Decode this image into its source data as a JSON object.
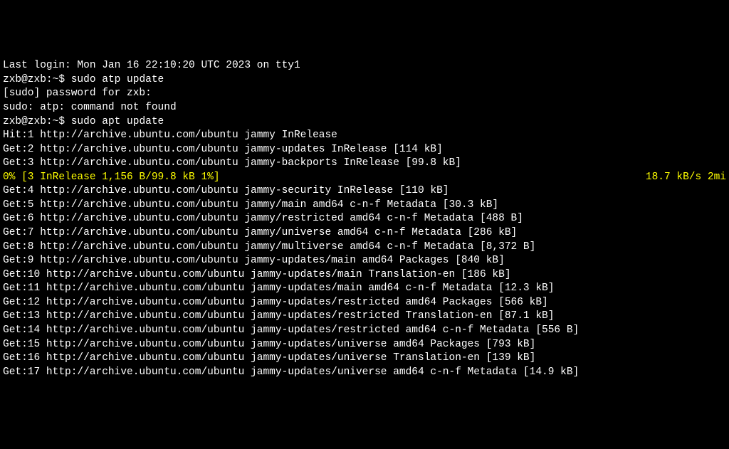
{
  "lines": {
    "last_login": "Last login: Mon Jan 16 22:10:20 UTC 2023 on tty1",
    "prompt1_user": "zxb@zxb",
    "prompt1_path": ":~$ ",
    "prompt1_cmd": "sudo atp update",
    "sudo_pw": "[sudo] password for zxb:",
    "sudo_err": "sudo: atp: command not found",
    "prompt2_user": "zxb@zxb",
    "prompt2_path": ":~$ ",
    "prompt2_cmd": "sudo apt update",
    "hit1": "Hit:1 http://archive.ubuntu.com/ubuntu jammy InRelease",
    "get2": "Get:2 http://archive.ubuntu.com/ubuntu jammy-updates InRelease [114 kB]",
    "get3": "Get:3 http://archive.ubuntu.com/ubuntu jammy-backports InRelease [99.8 kB]",
    "progress_left": "0% [3 InRelease 1,156 B/99.8 kB 1%]",
    "progress_right": "18.7 kB/s 2mi",
    "get4": "Get:4 http://archive.ubuntu.com/ubuntu jammy-security InRelease [110 kB]",
    "get5": "Get:5 http://archive.ubuntu.com/ubuntu jammy/main amd64 c-n-f Metadata [30.3 kB]",
    "get6": "Get:6 http://archive.ubuntu.com/ubuntu jammy/restricted amd64 c-n-f Metadata [488 B]",
    "get7": "Get:7 http://archive.ubuntu.com/ubuntu jammy/universe amd64 c-n-f Metadata [286 kB]",
    "get8": "Get:8 http://archive.ubuntu.com/ubuntu jammy/multiverse amd64 c-n-f Metadata [8,372 B]",
    "get9": "Get:9 http://archive.ubuntu.com/ubuntu jammy-updates/main amd64 Packages [840 kB]",
    "get10": "Get:10 http://archive.ubuntu.com/ubuntu jammy-updates/main Translation-en [186 kB]",
    "get11": "Get:11 http://archive.ubuntu.com/ubuntu jammy-updates/main amd64 c-n-f Metadata [12.3 kB]",
    "get12": "Get:12 http://archive.ubuntu.com/ubuntu jammy-updates/restricted amd64 Packages [566 kB]",
    "get13": "Get:13 http://archive.ubuntu.com/ubuntu jammy-updates/restricted Translation-en [87.1 kB]",
    "get14": "Get:14 http://archive.ubuntu.com/ubuntu jammy-updates/restricted amd64 c-n-f Metadata [556 B]",
    "get15": "Get:15 http://archive.ubuntu.com/ubuntu jammy-updates/universe amd64 Packages [793 kB]",
    "get16": "Get:16 http://archive.ubuntu.com/ubuntu jammy-updates/universe Translation-en [139 kB]",
    "get17": "Get:17 http://archive.ubuntu.com/ubuntu jammy-updates/universe amd64 c-n-f Metadata [14.9 kB]"
  }
}
